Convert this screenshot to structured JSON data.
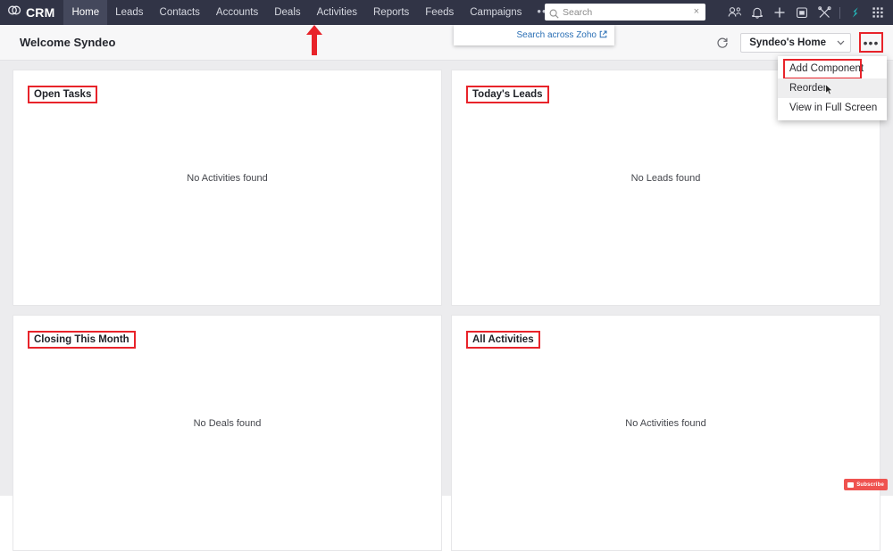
{
  "app": {
    "brand": "CRM",
    "brand_icon": "zoho-crm-logo-icon"
  },
  "topnav": {
    "items": [
      {
        "label": "Home",
        "active": true
      },
      {
        "label": "Leads",
        "active": false
      },
      {
        "label": "Contacts",
        "active": false
      },
      {
        "label": "Accounts",
        "active": false
      },
      {
        "label": "Deals",
        "active": false
      },
      {
        "label": "Activities",
        "active": false
      },
      {
        "label": "Reports",
        "active": false
      },
      {
        "label": "Feeds",
        "active": false
      },
      {
        "label": "Campaigns",
        "active": false
      }
    ],
    "overflow_label": "•••",
    "icons": [
      "contacts-people-icon",
      "notification-bell-icon",
      "add-plus-icon",
      "calendar-icon",
      "setup-tools-icon",
      "zoho-one-icon",
      "apps-grid-icon"
    ]
  },
  "search": {
    "placeholder": "Search",
    "value": "",
    "clear_label": "×",
    "icon": "search-icon",
    "across_zoho_label": "Search across Zoho",
    "across_zoho_icon": "external-link-icon"
  },
  "subheader": {
    "welcome_title": "Welcome Syndeo",
    "refresh_icon": "refresh-icon",
    "home_selector": {
      "label": "Syndeo's Home",
      "caret_icon": "chevron-down-icon"
    },
    "more_label": "•••"
  },
  "menu": {
    "items": [
      {
        "label": "Add Component",
        "highlighted": true,
        "hover": false
      },
      {
        "label": "Reorder",
        "highlighted": false,
        "hover": true
      },
      {
        "label": "View in Full Screen",
        "highlighted": false,
        "hover": false
      }
    ]
  },
  "dashboard": {
    "cards": [
      {
        "title": "Open Tasks",
        "empty_message": "No Activities found"
      },
      {
        "title": "Today's Leads",
        "empty_message": "No Leads found"
      },
      {
        "title": "Closing This Month",
        "empty_message": "No Deals found"
      },
      {
        "title": "All Activities",
        "empty_message": "No Activities found"
      }
    ]
  },
  "annotations": {
    "arrow_target": "Activities",
    "accent_color": "#e8232a"
  },
  "subscribe_badge": {
    "label": "Subscribe",
    "color": "#ef5350"
  }
}
